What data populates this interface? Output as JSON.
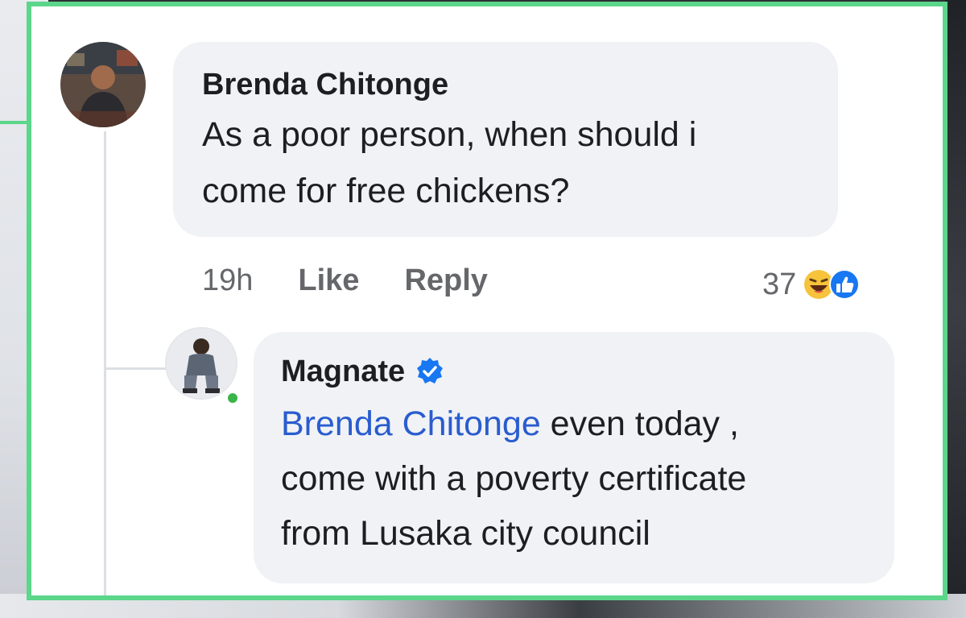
{
  "comment": {
    "author": "Brenda Chitonge",
    "text_line1": "As a poor person, when should i",
    "text_line2": "come for free chickens?",
    "time": "19h",
    "like_label": "Like",
    "reply_label": "Reply",
    "reaction_count": "37",
    "reaction_icons": [
      "haha-emoji-icon",
      "like-icon"
    ]
  },
  "reply": {
    "author": "Magnate",
    "verified_icon": "verified-badge-icon",
    "mention": "Brenda Chitonge",
    "text_line1_rest": " even today ,",
    "text_line2": "come with a poverty certificate",
    "text_line3": "from Lusaka city council",
    "online": true
  },
  "colors": {
    "frame_border": "#5bd68a",
    "bubble": "#f0f2f5",
    "mention": "#2a5ccf",
    "verified": "#1877f2",
    "online": "#3bb54a"
  }
}
